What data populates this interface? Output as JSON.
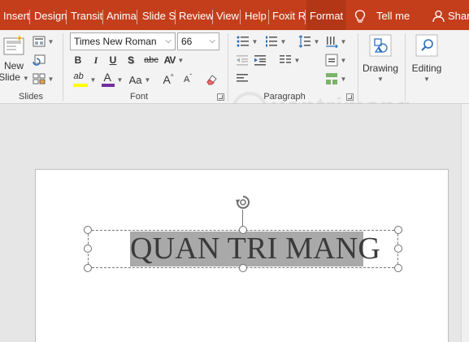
{
  "tabs": [
    {
      "label": "Insert"
    },
    {
      "label": "Design"
    },
    {
      "label": "Transit"
    },
    {
      "label": "Anima"
    },
    {
      "label": "Slide Sl"
    },
    {
      "label": "Review"
    },
    {
      "label": "View"
    },
    {
      "label": "Help"
    },
    {
      "label": "Foxit R"
    },
    {
      "label": "Format"
    }
  ],
  "tell_me": "Tell me",
  "share": "Shar",
  "ribbon": {
    "slides": {
      "group_label": "Slides",
      "new_slide_line1": "New",
      "new_slide_line2": "Slide"
    },
    "font": {
      "group_label": "Font",
      "font_name": "Times New Roman",
      "font_size": "66",
      "bold": "B",
      "italic": "I",
      "underline": "U",
      "shadow": "S",
      "strike": "abc",
      "spacing": "AV",
      "highlight": "ab",
      "font_color": "A",
      "change_case": "Aa",
      "grow": "A",
      "shrink": "A"
    },
    "paragraph": {
      "group_label": "Paragraph"
    },
    "drawing": {
      "label": "Drawing"
    },
    "editing": {
      "label": "Editing"
    }
  },
  "watermark": "uantrimang",
  "slide": {
    "title_text": "QUAN TRI MANG"
  },
  "colors": {
    "tab_bar": "#c43e1c",
    "highlight_bar": "#ffff00",
    "font_color_bar": "#7030a0",
    "selection": "#a9a9a9"
  }
}
